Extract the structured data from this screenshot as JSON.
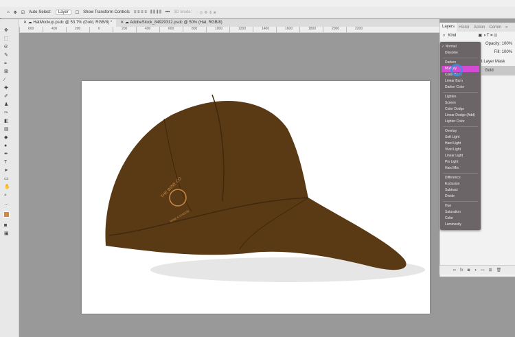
{
  "options_bar": {
    "home": "⌂",
    "move": "✥",
    "auto_select_label": "Auto-Select:",
    "auto_select_value": "Layer",
    "show_transform": "Show Transform Controls",
    "more": "•••",
    "mode_3d": "3D Mode:"
  },
  "tabs": [
    {
      "label": "HatMockup.psdc @ 53.7% (Gold, RGB/8) *",
      "active": true
    },
    {
      "label": "AdobeStock_84929312.psdc @ 50% (Hat, RGB/8)",
      "active": false
    }
  ],
  "ruler": [
    "600",
    "400",
    "200",
    "0",
    "200",
    "400",
    "600",
    "800",
    "1000",
    "1200",
    "1400",
    "1600",
    "1800",
    "2000",
    "2200"
  ],
  "panel": {
    "tabs": [
      "Layers",
      "Histor",
      "Action",
      "Comm"
    ],
    "kind": "Kind",
    "opacity_label": "Opacity:",
    "opacity": "100%",
    "fill_label": "Fill:",
    "fill": "100%",
    "mask_text": "t Layer Mask",
    "layer_name": "Gold"
  },
  "blend_menu": {
    "groups": [
      [
        "Normal",
        "Dissolve"
      ],
      [
        "Darken",
        "Multiply",
        "Color Burn",
        "Linear Burn",
        "Darker Color"
      ],
      [
        "Lighten",
        "Screen",
        "Color Dodge",
        "Linear Dodge (Add)",
        "Lighter Color"
      ],
      [
        "Overlay",
        "Soft Light",
        "Hard Light",
        "Vivid Light",
        "Linear Light",
        "Pin Light",
        "Hard Mix"
      ],
      [
        "Difference",
        "Exclusion",
        "Subtract",
        "Divide"
      ],
      [
        "Hue",
        "Saturation",
        "Color",
        "Luminosity"
      ]
    ],
    "selected": "Normal",
    "highlighted": "Multiply"
  },
  "logo": {
    "line1": "THE WINE CO",
    "line2": "WINE & CHEESE"
  },
  "colors": {
    "cap": "#5a3a14",
    "logo": "#c98a4a",
    "highlight": "#d44ad4",
    "menu_bg": "#6b6568"
  }
}
